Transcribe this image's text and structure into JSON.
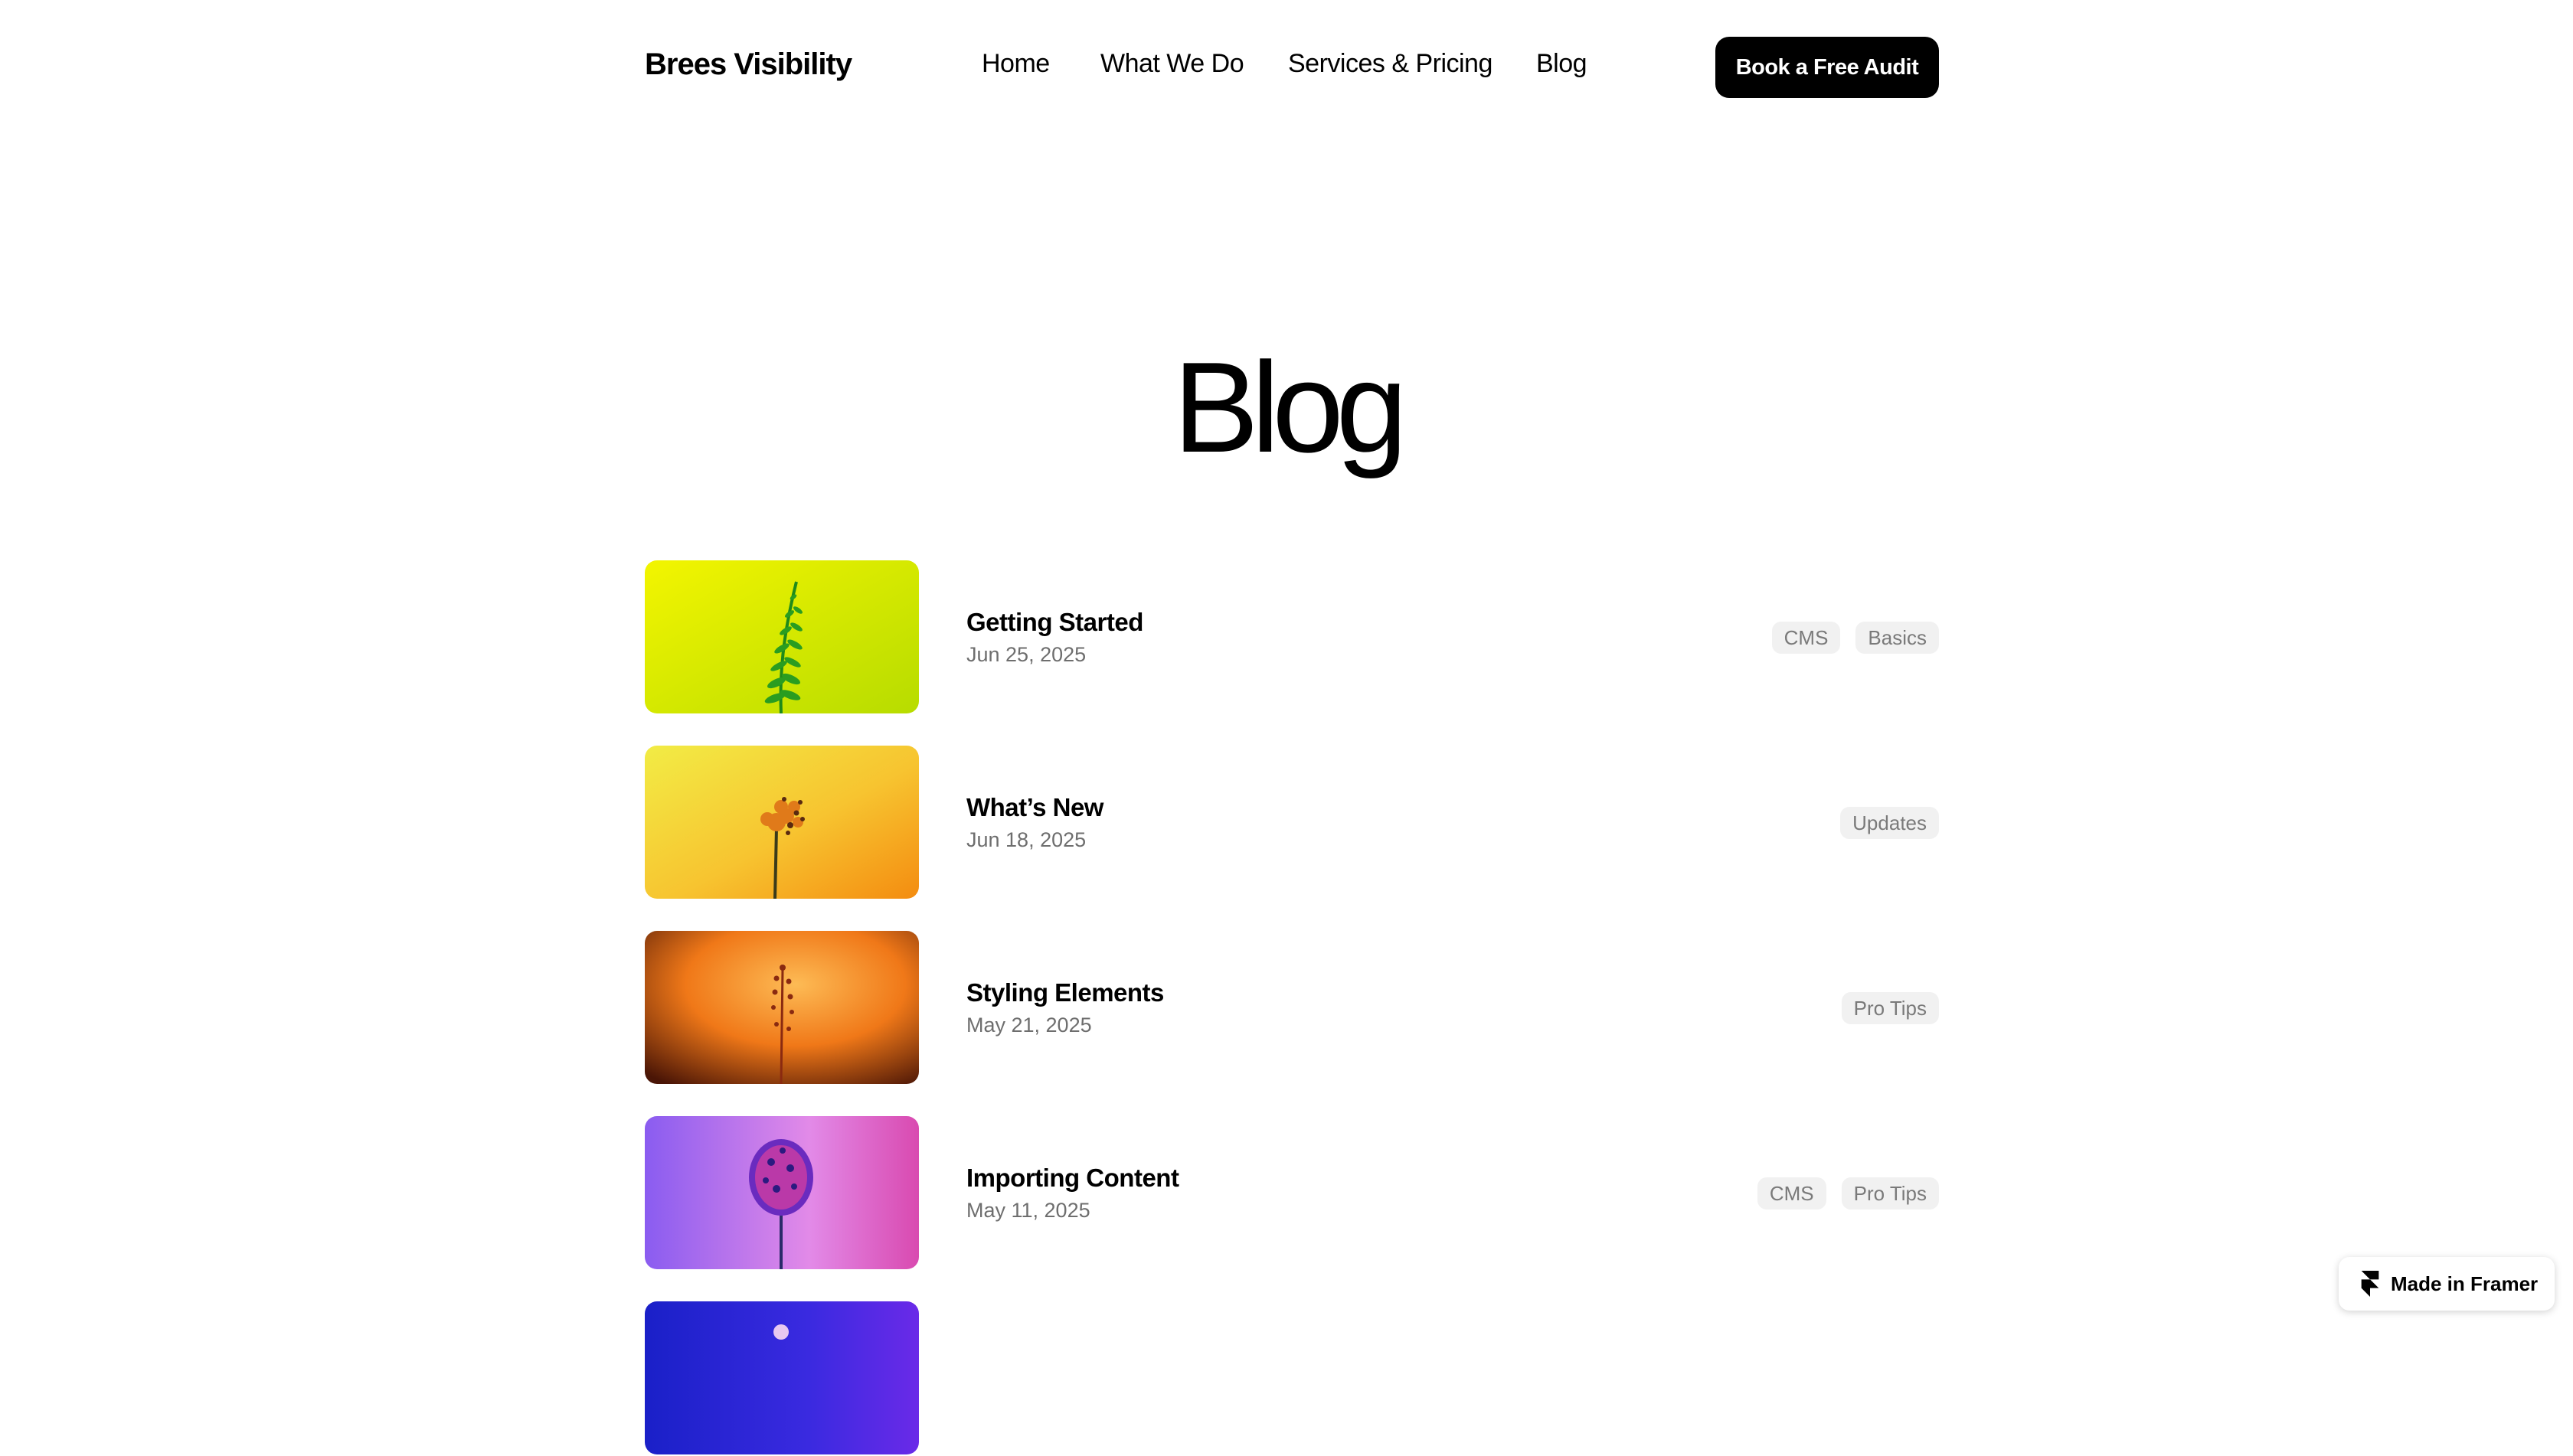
{
  "header": {
    "logo": "Brees Visibility",
    "nav": [
      "Home",
      "What We Do",
      "Services & Pricing",
      "Blog"
    ],
    "cta": "Book a Free Audit"
  },
  "page_title": "Blog",
  "posts": [
    {
      "title": "Getting Started",
      "date": "Jun 25, 2025",
      "tags": [
        "CMS",
        "Basics"
      ]
    },
    {
      "title": "What’s New",
      "date": "Jun 18, 2025",
      "tags": [
        "Updates"
      ]
    },
    {
      "title": "Styling Elements",
      "date": "May 21, 2025",
      "tags": [
        "Pro Tips"
      ]
    },
    {
      "title": "Importing Content",
      "date": "May 11, 2025",
      "tags": [
        "CMS",
        "Pro Tips"
      ]
    }
  ],
  "badge": {
    "label": "Made in Framer",
    "icon": "framer-logo-icon"
  },
  "colors": {
    "accent": "#000000",
    "tag_bg": "#f1f1f1",
    "tag_text": "#7a7a7a"
  }
}
